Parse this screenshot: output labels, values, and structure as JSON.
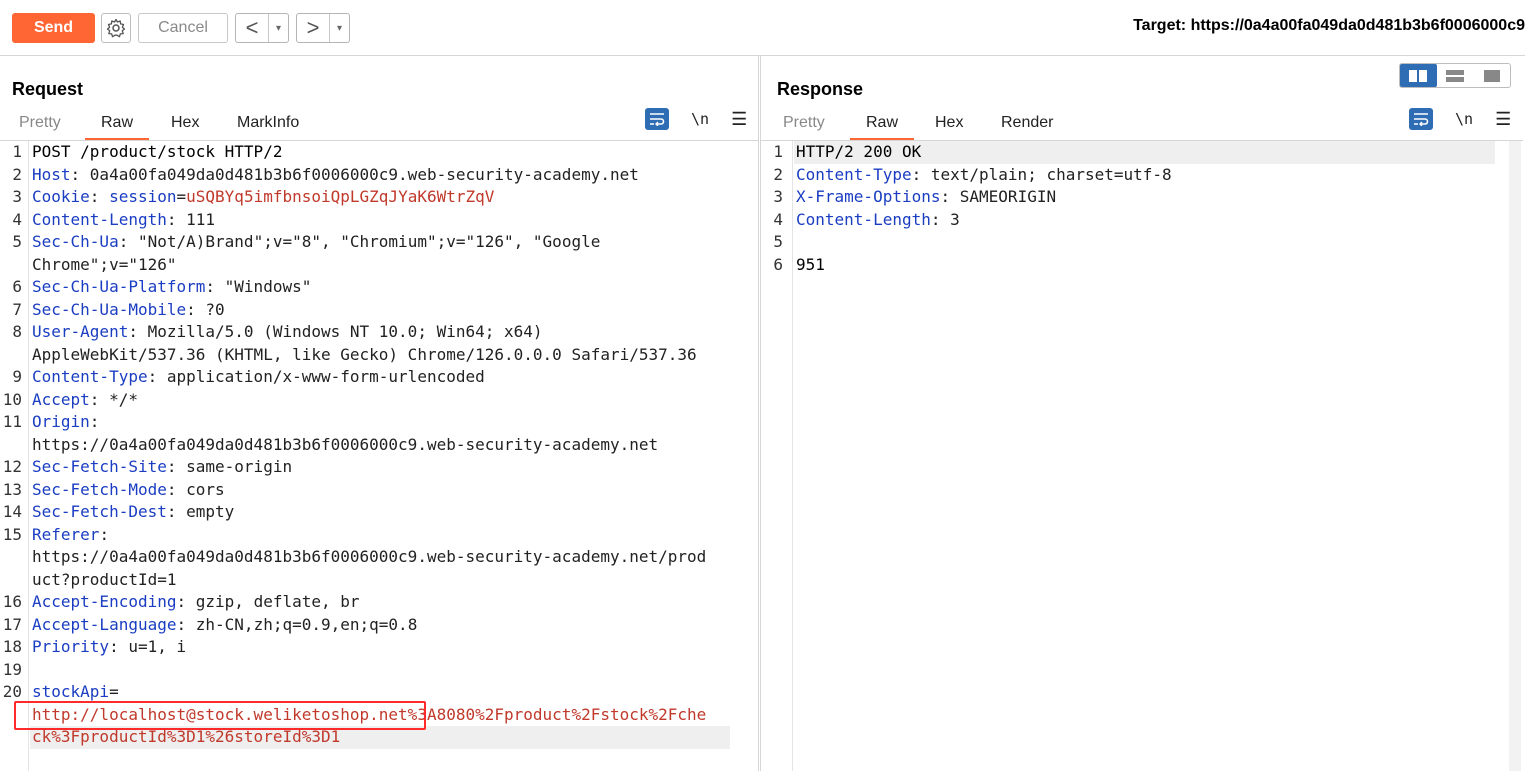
{
  "toolbar": {
    "send_label": "Send",
    "cancel_label": "Cancel",
    "back_arrow": "<",
    "forward_arrow": ">",
    "dropdown_glyph": "▾",
    "target_text": "Target: https://0a4a00fa049da0d481b3b6f0006000c9"
  },
  "request": {
    "title": "Request",
    "tabs": [
      "Pretty",
      "Raw",
      "Hex",
      "MarkInfo"
    ],
    "active_tab": "Raw",
    "tools": {
      "newline": "\\n",
      "menu": "☰"
    },
    "lines": [
      {
        "n": "1",
        "text": "POST /product/stock HTTP/2"
      },
      {
        "n": "2",
        "key": "Host",
        "sep": ": ",
        "val": "0a4a00fa049da0d481b3b6f0006000c9.web-security-academy.net"
      },
      {
        "n": "3",
        "key": "Cookie",
        "sep": ": ",
        "key2": "session",
        "sep2": "=",
        "cval": "uSQBYq5imfbnsoiQpLGZqJYaK6WtrZqV"
      },
      {
        "n": "4",
        "key": "Content-Length",
        "sep": ": ",
        "val": "111"
      },
      {
        "n": "5",
        "key": "Sec-Ch-Ua",
        "sep": ": ",
        "val": "\"Not/A)Brand\";v=\"8\", \"Chromium\";v=\"126\", \"Google"
      },
      {
        "n": "",
        "val": "Chrome\";v=\"126\""
      },
      {
        "n": "6",
        "key": "Sec-Ch-Ua-Platform",
        "sep": ": ",
        "val": "\"Windows\""
      },
      {
        "n": "7",
        "key": "Sec-Ch-Ua-Mobile",
        "sep": ": ",
        "val": "?0"
      },
      {
        "n": "8",
        "key": "User-Agent",
        "sep": ": ",
        "val": "Mozilla/5.0 (Windows NT 10.0; Win64; x64)"
      },
      {
        "n": "",
        "val": "AppleWebKit/537.36 (KHTML, like Gecko) Chrome/126.0.0.0 Safari/537.36"
      },
      {
        "n": "9",
        "key": "Content-Type",
        "sep": ": ",
        "val": "application/x-www-form-urlencoded"
      },
      {
        "n": "10",
        "key": "Accept",
        "sep": ": ",
        "val": "*/*"
      },
      {
        "n": "11",
        "key": "Origin",
        "sep": ":",
        "val": ""
      },
      {
        "n": "",
        "val": "https://0a4a00fa049da0d481b3b6f0006000c9.web-security-academy.net"
      },
      {
        "n": "12",
        "key": "Sec-Fetch-Site",
        "sep": ": ",
        "val": "same-origin"
      },
      {
        "n": "13",
        "key": "Sec-Fetch-Mode",
        "sep": ": ",
        "val": "cors"
      },
      {
        "n": "14",
        "key": "Sec-Fetch-Dest",
        "sep": ": ",
        "val": "empty"
      },
      {
        "n": "15",
        "key": "Referer",
        "sep": ":",
        "val": ""
      },
      {
        "n": "",
        "val": "https://0a4a00fa049da0d481b3b6f0006000c9.web-security-academy.net/prod"
      },
      {
        "n": "",
        "val": "uct?productId=1"
      },
      {
        "n": "16",
        "key": "Accept-Encoding",
        "sep": ": ",
        "val": "gzip, deflate, br"
      },
      {
        "n": "17",
        "key": "Accept-Language",
        "sep": ": ",
        "val": "zh-CN,zh;q=0.9,en;q=0.8"
      },
      {
        "n": "18",
        "key": "Priority",
        "sep": ": ",
        "val": "u=1, i"
      },
      {
        "n": "19",
        "text": ""
      },
      {
        "n": "20",
        "key": "stockApi",
        "sep": "=",
        "val": ""
      },
      {
        "n": "",
        "cval": "http://localhost@stock.weliketoshop.net%3A8080%2Fproduct%2Fstock%2Fche"
      },
      {
        "n": "",
        "cval": "ck%3FproductId%3D1%26storeId%3D1",
        "hl": true
      }
    ]
  },
  "response": {
    "title": "Response",
    "tabs": [
      "Pretty",
      "Raw",
      "Hex",
      "Render"
    ],
    "active_tab": "Raw",
    "tools": {
      "newline": "\\n",
      "menu": "☰"
    },
    "lines": [
      {
        "n": "1",
        "text": "HTTP/2 200 OK",
        "hl": true
      },
      {
        "n": "2",
        "key": "Content-Type",
        "sep": ": ",
        "val": "text/plain; charset=utf-8"
      },
      {
        "n": "3",
        "key": "X-Frame-Options",
        "sep": ": ",
        "val": "SAMEORIGIN"
      },
      {
        "n": "4",
        "key": "Content-Length",
        "sep": ": ",
        "val": "3"
      },
      {
        "n": "5",
        "text": ""
      },
      {
        "n": "6",
        "text": "951"
      }
    ]
  },
  "colors": {
    "accent": "#ff6633",
    "header_key": "#1a3dc2",
    "cookie_value": "#c0392b",
    "highlight_box": "#ff2a2a",
    "tool_blue": "#2e6db4"
  }
}
